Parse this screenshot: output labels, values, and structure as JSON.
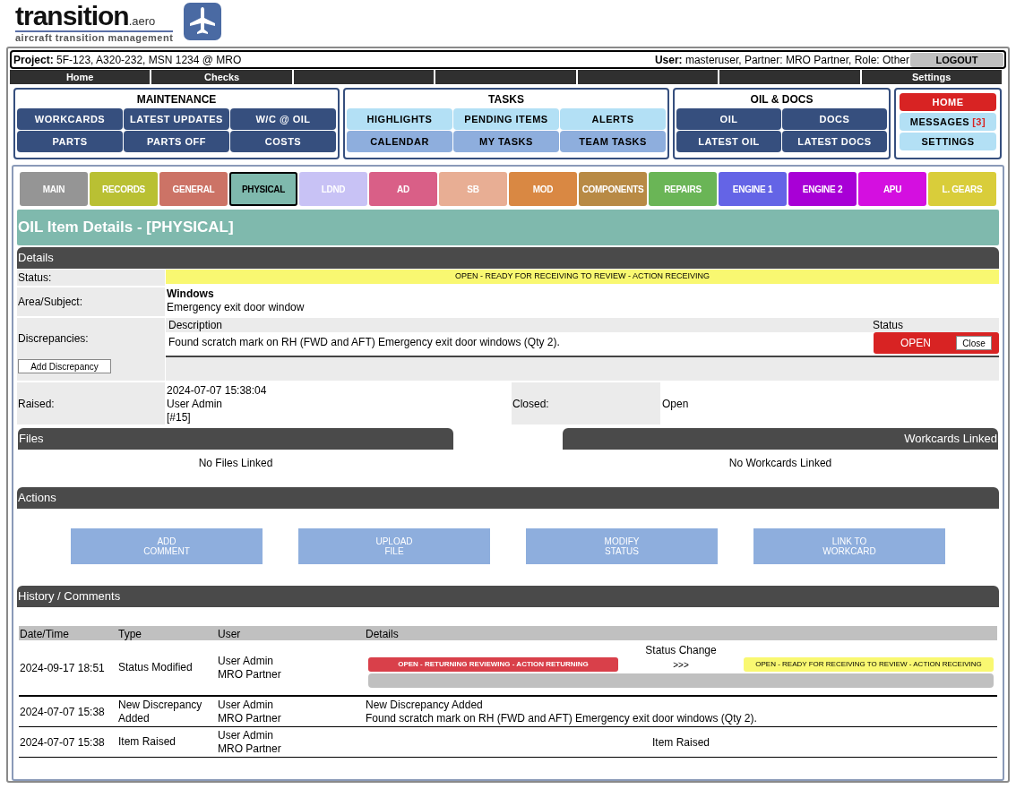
{
  "logo": {
    "name": "transition",
    "suffix": ".aero",
    "tagline": "aircraft transition management"
  },
  "project": {
    "label": "Project:",
    "value": "5F-123, A320-232, MSN 1234 @ MRO",
    "user_label": "User:",
    "user_value": "masteruser, Partner: MRO Partner, Role: Other",
    "logout": "LOGOUT"
  },
  "nav": {
    "left": [
      "Home",
      "Checks"
    ],
    "right": [
      "Settings"
    ]
  },
  "menus": [
    {
      "title": "MAINTENANCE",
      "buttons": [
        {
          "label": "WORKCARDS",
          "kind": "dark"
        },
        {
          "label": "LATEST UPDATES",
          "kind": "dark"
        },
        {
          "label": "W/C @ OIL",
          "kind": "dark"
        },
        {
          "label": "PARTS",
          "kind": "dark"
        },
        {
          "label": "PARTS OFF",
          "kind": "dark"
        },
        {
          "label": "COSTS",
          "kind": "dark"
        }
      ]
    },
    {
      "title": "TASKS",
      "buttons": [
        {
          "label": "HIGHLIGHTS",
          "kind": "light"
        },
        {
          "label": "PENDING ITEMS",
          "kind": "light"
        },
        {
          "label": "ALERTS",
          "kind": "light"
        },
        {
          "label": "CALENDAR",
          "kind": "mid"
        },
        {
          "label": "MY TASKS",
          "kind": "mid"
        },
        {
          "label": "TEAM TASKS",
          "kind": "mid"
        }
      ]
    },
    {
      "title": "OIL & DOCS",
      "buttons": [
        {
          "label": "OIL",
          "kind": "dark"
        },
        {
          "label": "DOCS",
          "kind": "dark"
        },
        {
          "label": "LATEST OIL",
          "kind": "dark"
        },
        {
          "label": "LATEST DOCS",
          "kind": "dark"
        }
      ]
    }
  ],
  "quick": [
    {
      "label": "HOME",
      "kind": "red"
    },
    {
      "label": "MESSAGES",
      "count": "[3]",
      "kind": "light"
    },
    {
      "label": "SETTINGS",
      "kind": "light"
    }
  ],
  "tabs": [
    {
      "label": "MAIN",
      "color": "#959595",
      "selected": false
    },
    {
      "label": "RECORDS",
      "color": "#b9c033",
      "selected": false
    },
    {
      "label": "GENERAL",
      "color": "#cc7366",
      "selected": false
    },
    {
      "label": "PHYSICAL",
      "color": "#7fb9ad",
      "selected": true
    },
    {
      "label": "LDND",
      "color": "#c8c2f5",
      "selected": false
    },
    {
      "label": "AD",
      "color": "#d95f87",
      "selected": false
    },
    {
      "label": "SB",
      "color": "#e8ae94",
      "selected": false
    },
    {
      "label": "MOD",
      "color": "#d98843",
      "selected": false
    },
    {
      "label": "COMPONENTS",
      "color": "#b88a45",
      "selected": false
    },
    {
      "label": "REPAIRS",
      "color": "#6ab556",
      "selected": false
    },
    {
      "label": "ENGINE 1",
      "color": "#6464e6",
      "selected": false
    },
    {
      "label": "ENGINE 2",
      "color": "#a800d6",
      "selected": false
    },
    {
      "label": "APU",
      "color": "#d40fe0",
      "selected": false
    },
    {
      "label": "L. GEARS",
      "color": "#d9cd3a",
      "selected": false
    }
  ],
  "page_title": "OIL Item Details - [PHYSICAL]",
  "details": {
    "header": "Details",
    "status_label": "Status:",
    "status": "OPEN - READY FOR RECEIVING TO REVIEW - ACTION RECEIVING",
    "area_label": "Area/Subject:",
    "area_title": "Windows",
    "area_text": "Emergency exit door window",
    "disc_label": "Discrepancies:",
    "add_button": "Add Discrepancy",
    "disc_columns": [
      "Description",
      "Status"
    ],
    "discrepancies": [
      {
        "description": "Found scratch mark on RH (FWD and AFT) Emergency exit door windows (Qty 2).",
        "status": "OPEN",
        "action": "Close"
      }
    ],
    "raised_label": "Raised:",
    "raised": [
      "2024-07-07 15:38:04",
      "User Admin",
      "[#15]"
    ],
    "closed_label": "Closed:",
    "closed": "Open"
  },
  "files": {
    "header": "Files",
    "empty": "No Files Linked"
  },
  "workcards": {
    "header": "Workcards Linked",
    "empty": "No Workcards Linked"
  },
  "actions": {
    "header": "Actions",
    "buttons": [
      [
        "ADD",
        "COMMENT"
      ],
      [
        "UPLOAD",
        "FILE"
      ],
      [
        "MODIFY",
        "STATUS"
      ],
      [
        "LINK TO",
        "WORKCARD"
      ]
    ]
  },
  "history": {
    "header": "History / Comments",
    "columns": [
      "Date/Time",
      "Type",
      "User",
      "Details"
    ],
    "rows": [
      {
        "date": "2024-09-17 18:51",
        "type": "Status Modified",
        "user": [
          "User Admin",
          "MRO Partner"
        ],
        "kind": "status_change",
        "title": "Status Change",
        "badges": [
          {
            "label": "OPEN - RETURNING REVIEWING - ACTION RETURNING",
            "color": "#d9404a"
          },
          {
            "label": "OPEN - READY FOR RECEIVING TO REVIEW - ACTION RECEIVING",
            "color": "#f9f871"
          }
        ],
        "arrow": ">>>",
        "progress": {
          "level": 0
        }
      },
      {
        "date": "2024-07-07 15:38",
        "type": "New Discrepancy Added",
        "user": [
          "User Admin",
          "MRO Partner"
        ],
        "kind": "text",
        "lines": [
          "New Discrepancy Added",
          "Found scratch mark on RH (FWD and AFT) Emergency exit door windows (Qty 2)."
        ]
      },
      {
        "date": "2024-07-07 15:38",
        "type": "Item Raised",
        "user": [
          "User Admin",
          "MRO Partner"
        ],
        "kind": "centered",
        "lines": [
          "Item Raised"
        ]
      }
    ]
  }
}
